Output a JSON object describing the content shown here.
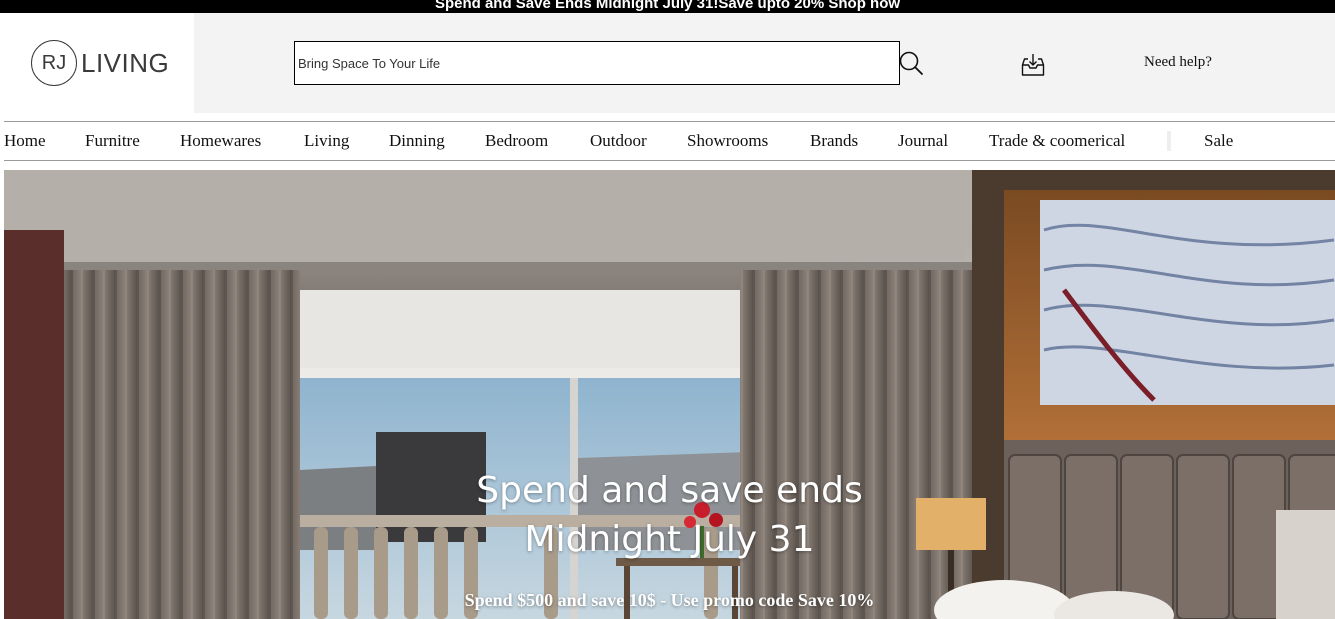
{
  "promo": {
    "text": "Spend and Save Ends Midnight July 31!Save upto 20% Shop now"
  },
  "header": {
    "logo_mark": "RJ",
    "logo_word": "LIVING",
    "search_placeholder": "Bring Space To Your Life",
    "search_icon": "search-icon",
    "download_icon": "download-tray-icon",
    "help_label": "Need help?"
  },
  "nav": {
    "items": [
      {
        "label": "Home"
      },
      {
        "label": "Furnitre"
      },
      {
        "label": "Homewares"
      },
      {
        "label": "Living"
      },
      {
        "label": "Dinning"
      },
      {
        "label": "Bedroom"
      },
      {
        "label": "Outdoor"
      },
      {
        "label": "Showrooms"
      },
      {
        "label": "Brands"
      },
      {
        "label": "Journal"
      },
      {
        "label": "Trade & coomerical"
      },
      {
        "label": "Sale"
      }
    ]
  },
  "hero": {
    "title_line1": "Spend and save ends",
    "title_line2": "Midnight July 31",
    "subtitle": "Spend $500 and save 10$ - Use promo code Save 10%"
  }
}
